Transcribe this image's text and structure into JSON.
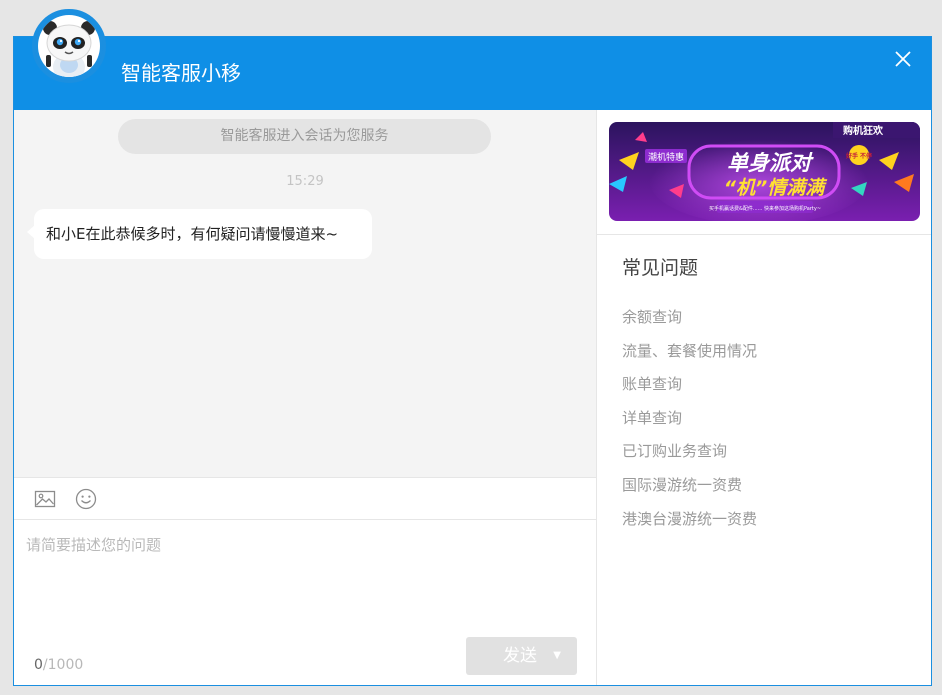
{
  "header": {
    "title": "智能客服小移",
    "brand_color": "#0f8fe6",
    "close_icon": "close-icon",
    "avatar_icon": "panda-robot-avatar"
  },
  "chat": {
    "system_message": "智能客服进入会话为您服务",
    "timestamp": "15:29",
    "messages": [
      {
        "from": "bot",
        "text": "和小E在此恭候多时，有何疑问请慢慢道来~"
      }
    ]
  },
  "toolbar": {
    "icons": [
      "image-icon",
      "emoji-icon"
    ]
  },
  "input": {
    "placeholder": "请简要描述您的问题",
    "counter_current": "0",
    "counter_max": "/1000",
    "send_label": "发送",
    "send_dropdown_icon": "▼"
  },
  "sidebar": {
    "banner": {
      "badge": "购机狂欢",
      "tag": "潮机特惠",
      "headline_line1": "单身派对",
      "headline_line2": "“机”情满满",
      "sub_badge": "好手 不停",
      "subtitle": "买手机赢话费&配件...... 快来参加这场购机Party~"
    },
    "faq_title": "常见问题",
    "faq_items": [
      "余额查询",
      "流量、套餐使用情况",
      "账单查询",
      "详单查询",
      "已订购业务查询",
      "国际漫游统一资费",
      "港澳台漫游统一资费"
    ]
  }
}
